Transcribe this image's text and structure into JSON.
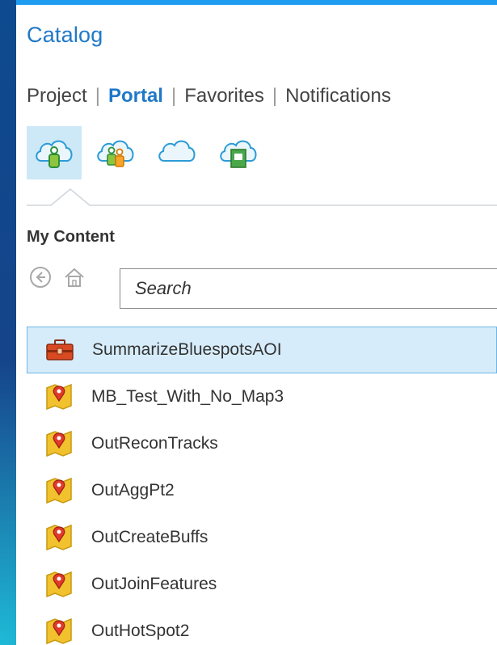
{
  "panel": {
    "title": "Catalog",
    "accent": "#1f78c8"
  },
  "tabs": [
    {
      "label": "Project",
      "active": false
    },
    {
      "label": "Portal",
      "active": true
    },
    {
      "label": "Favorites",
      "active": false
    },
    {
      "label": "Notifications",
      "active": false
    }
  ],
  "portal_icons": [
    {
      "name": "my-content-cloud-icon",
      "selected": true
    },
    {
      "name": "groups-cloud-icon",
      "selected": false
    },
    {
      "name": "all-portal-cloud-icon",
      "selected": false
    },
    {
      "name": "living-atlas-cloud-icon",
      "selected": false
    }
  ],
  "section": {
    "label": "My Content"
  },
  "navigation": {
    "back_icon": "back-arrow-icon",
    "home_icon": "home-icon"
  },
  "search": {
    "placeholder": "Search",
    "value": ""
  },
  "items": [
    {
      "label": "SummarizeBluespotsAOI",
      "icon": "toolbox-icon",
      "selected": true
    },
    {
      "label": "MB_Test_With_No_Map3",
      "icon": "map-package-icon",
      "selected": false
    },
    {
      "label": "OutReconTracks",
      "icon": "map-package-icon",
      "selected": false
    },
    {
      "label": "OutAggPt2",
      "icon": "map-package-icon",
      "selected": false
    },
    {
      "label": "OutCreateBuffs",
      "icon": "map-package-icon",
      "selected": false
    },
    {
      "label": "OutJoinFeatures",
      "icon": "map-package-icon",
      "selected": false
    },
    {
      "label": "OutHotSpot2",
      "icon": "map-package-icon",
      "selected": false
    }
  ]
}
